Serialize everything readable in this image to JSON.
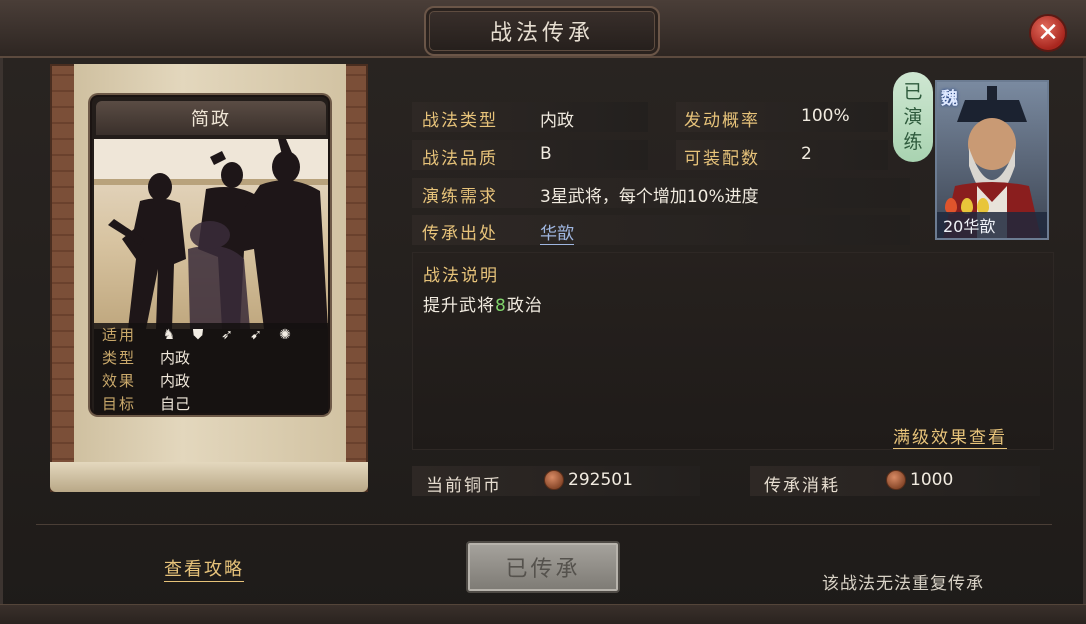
{
  "window": {
    "title": "战法传承",
    "close_icon": "close-icon"
  },
  "card": {
    "name": "简政",
    "props": [
      {
        "label": "适用",
        "icons": [
          "cavalry-icon",
          "shield-icon",
          "bow-icon",
          "spear-icon",
          "wheel-icon"
        ]
      },
      {
        "label": "类型",
        "value": "内政"
      },
      {
        "label": "效果",
        "value": "内政"
      },
      {
        "label": "目标",
        "value": "自己"
      }
    ]
  },
  "info": {
    "tactic_type": {
      "label": "战法类型",
      "value": "内政"
    },
    "trigger_rate": {
      "label": "发动概率",
      "value": "100%"
    },
    "quality": {
      "label": "战法品质",
      "value": "B"
    },
    "equip_count": {
      "label": "可装配数",
      "value": "2"
    },
    "practice_req": {
      "label": "演练需求",
      "value": "3星武将，每个增加10%进度"
    },
    "source": {
      "label": "传承出处",
      "value": "华歆"
    }
  },
  "practiced_badge": [
    "已",
    "演",
    "练"
  ],
  "portrait": {
    "faction": "魏",
    "level_name": "20华歆",
    "stars": 3,
    "star_colors": [
      "#e0542c",
      "#e8c53a",
      "#e8c53a"
    ]
  },
  "description": {
    "heading": "战法说明",
    "text_prefix": "提升武将",
    "number": "8",
    "text_suffix": "政治",
    "max_effect_link": "满级效果查看"
  },
  "currency": {
    "current": {
      "label": "当前铜币",
      "value": "292501"
    },
    "cost": {
      "label": "传承消耗",
      "value": "1000"
    }
  },
  "footer": {
    "guide_link": "查看攻略",
    "inherit_button": "已传承",
    "no_repeat_note": "该战法无法重复传承"
  }
}
